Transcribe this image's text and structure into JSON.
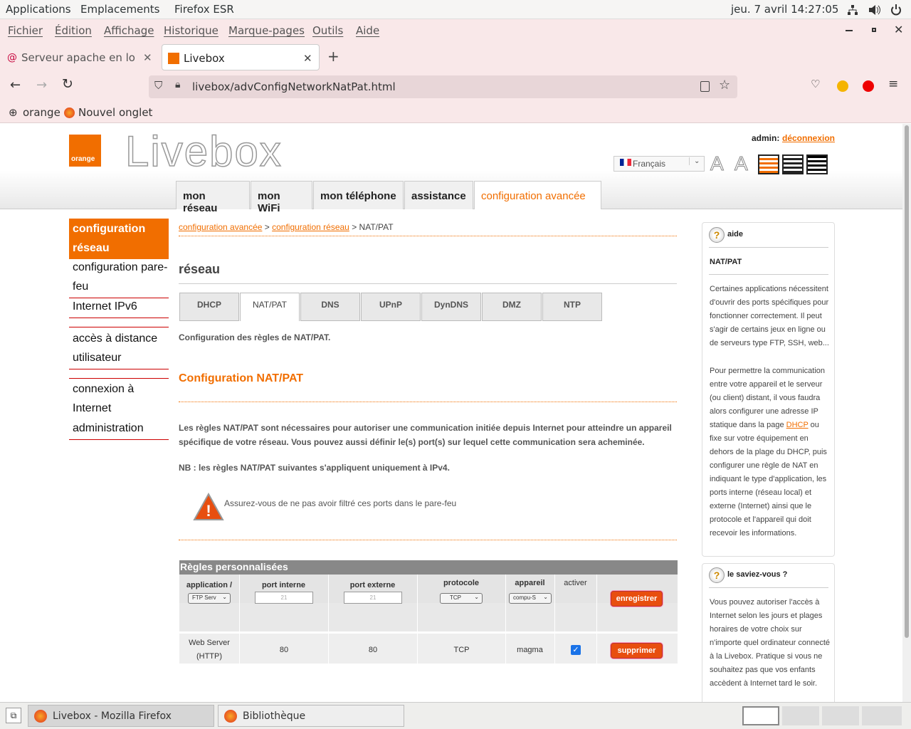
{
  "system": {
    "applications": "Applications",
    "places": "Emplacements",
    "app_name": "Firefox ESR",
    "clock": "jeu. 7 avril  14:27:05"
  },
  "menu": [
    "Fichier",
    "Édition",
    "Affichage",
    "Historique",
    "Marque-pages",
    "Outils",
    "Aide"
  ],
  "tabs": [
    {
      "title": "Serveur apache en local - ",
      "active": false
    },
    {
      "title": "Livebox",
      "active": true
    }
  ],
  "url": "livebox/advConfigNetworkNatPat.html",
  "bookmarks": [
    "orange",
    "Nouvel onglet"
  ],
  "livebox": {
    "brand": "orange",
    "title": "Livebox",
    "admin_label": "admin:",
    "logout": "déconnexion",
    "language": "Français",
    "nav": [
      "mon réseau",
      "mon WiFi",
      "mon téléphone",
      "assistance",
      "configuration avancée"
    ],
    "sidebar": [
      {
        "label": "configuration réseau",
        "active": true
      },
      {
        "label": "configuration pare-feu",
        "active": false
      },
      {
        "label": "Internet IPv6",
        "active": false
      },
      {
        "label": "accès à distance utilisateur",
        "active": false
      },
      {
        "label": "connexion à Internet",
        "active": false
      },
      {
        "label": "administration",
        "active": false
      }
    ],
    "breadcrumb": {
      "a": "configuration avancée",
      "sep1": " > ",
      "b": "configuration réseau",
      "sep2": " > ",
      "c": "NAT/PAT"
    },
    "section_title": "réseau",
    "subtabs": [
      "DHCP",
      "NAT/PAT",
      "DNS",
      "UPnP",
      "DynDNS",
      "DMZ",
      "NTP"
    ],
    "intro": "Configuration des règles de NAT/PAT.",
    "heading": "Configuration NAT/PAT",
    "desc": "Les règles NAT/PAT sont nécessaires pour autoriser une communication initiée depuis Internet pour atteindre un appareil spécifique de votre réseau. Vous pouvez aussi définir le(s) port(s) sur lequel cette communication sera acheminée.",
    "nb": "NB : les règles NAT/PAT suivantes s'appliquent uniquement à IPv4.",
    "warning": "Assurez-vous de ne pas avoir filtré ces ports dans le pare-feu",
    "table": {
      "title": "Règles personnalisées",
      "headers": [
        "application / service",
        "port interne",
        "port externe",
        "protocole",
        "appareil",
        "activer"
      ],
      "new_row": {
        "service": "FTP Serv",
        "internal_placeholder": "21",
        "external_placeholder": "21",
        "protocol": "TCP",
        "device": "compu-S",
        "button": "enregistrer"
      },
      "rows": [
        {
          "service": "Web Server (HTTP)",
          "internal": "80",
          "external": "80",
          "protocol": "TCP",
          "device": "magma",
          "active": true,
          "button": "supprimer"
        }
      ]
    },
    "help": {
      "title": "aide",
      "topic": "NAT/PAT",
      "p1": "Certaines applications nécessitent d'ouvrir des ports spécifiques pour fonctionner correctement. Il peut s'agir de certains jeux en ligne ou de serveurs type FTP, SSH, web...",
      "p2_before": "Pour permettre la communication entre votre appareil et le serveur (ou client) distant, il vous faudra alors configurer une adresse IP statique dans la page ",
      "p2_link": "DHCP",
      "p2_after": " ou fixe sur votre équipement en dehors de la plage du DHCP, puis configurer une règle de NAT en indiquant le type d'application, les ports interne (réseau local) et externe (Internet) ainsi que le protocole et l'appareil qui doit recevoir les informations."
    },
    "tip": {
      "title": "le saviez-vous ?",
      "text": "Vous pouvez autoriser l'accès à Internet selon les jours et plages horaires de votre choix sur n'importe quel ordinateur connecté à la Livebox. Pratique si vous ne souhaitez pas que vos enfants accèdent à Internet tard le soir."
    }
  },
  "taskbar": [
    {
      "label": "Livebox - Mozilla Firefox",
      "active": true
    },
    {
      "label": "Bibliothèque",
      "active": false
    }
  ]
}
